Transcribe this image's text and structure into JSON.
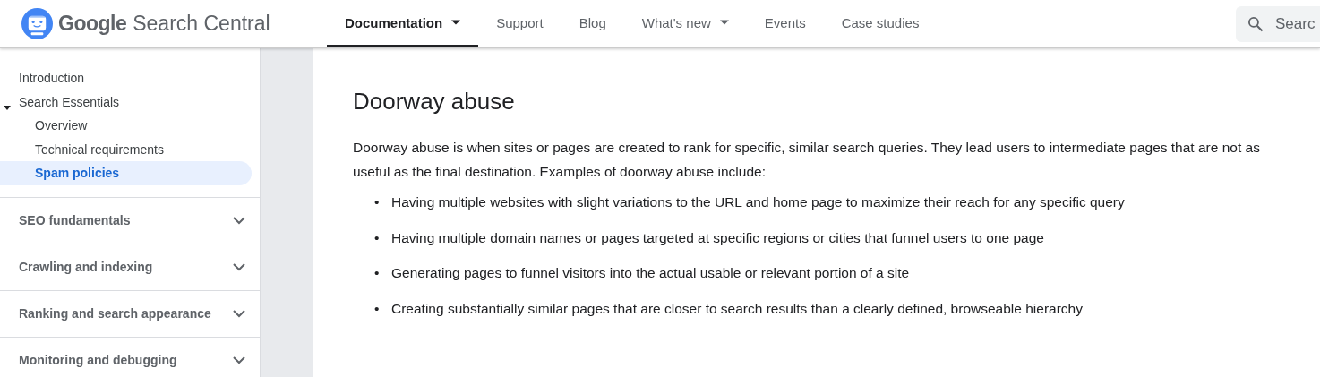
{
  "header": {
    "logo_text": {
      "brand": "Google",
      "product": "Search Central"
    },
    "nav": [
      {
        "label": "Documentation",
        "selected": true,
        "dropdown": true
      },
      {
        "label": "Support",
        "selected": false,
        "dropdown": false
      },
      {
        "label": "Blog",
        "selected": false,
        "dropdown": false
      },
      {
        "label": "What's new",
        "selected": false,
        "dropdown": true
      },
      {
        "label": "Events",
        "selected": false,
        "dropdown": false
      },
      {
        "label": "Case studies",
        "selected": false,
        "dropdown": false
      }
    ],
    "search": {
      "placeholder": "Searc"
    }
  },
  "sidebar": {
    "items": [
      {
        "label": "Introduction",
        "selected": false
      },
      {
        "label": "Search Essentials",
        "selected": false,
        "expanded": true,
        "children": [
          {
            "label": "Overview",
            "selected": false
          },
          {
            "label": "Technical requirements",
            "selected": false
          },
          {
            "label": "Spam policies",
            "selected": true
          }
        ]
      }
    ],
    "sections": [
      {
        "label": "SEO fundamentals",
        "expanded": false
      },
      {
        "label": "Crawling and indexing",
        "expanded": false
      },
      {
        "label": "Ranking and search appearance",
        "expanded": false
      },
      {
        "label": "Monitoring and debugging",
        "expanded": false
      }
    ]
  },
  "article": {
    "heading": "Doorway abuse",
    "paragraph": "Doorway abuse is when sites or pages are created to rank for specific, similar search queries. They lead users to intermediate pages that are not as useful as the final destination. Examples of doorway abuse include:",
    "bullets": [
      {
        "marker": "•",
        "text": "Having multiple websites with slight variations to the URL and home page to maximize their reach for any specific query"
      },
      {
        "marker": "•",
        "text": "Having multiple domain names or pages targeted at specific regions or cities that funnel users to one page"
      },
      {
        "marker": "•",
        "text": "Generating pages to funnel visitors into the actual usable or relevant portion of a site"
      },
      {
        "marker": "•",
        "text": "Creating substantially similar pages that are closer to search results than a clearly defined, browseable hierarchy"
      }
    ]
  }
}
